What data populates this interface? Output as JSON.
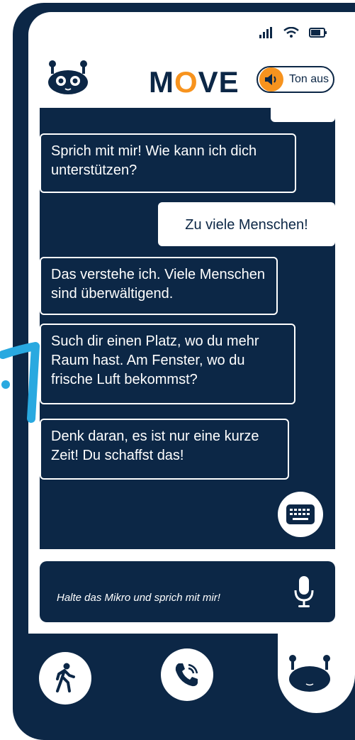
{
  "header": {
    "logo_text_left": "M",
    "logo_text_o": "O",
    "logo_text_right": "VE",
    "sound_label": "Ton aus"
  },
  "status_bar": {
    "icons": [
      "signal-icon",
      "wifi-icon",
      "battery-icon"
    ]
  },
  "messages": [
    {
      "from": "bot",
      "text": "Sprich mit mir! Wie kann ich dich unterstützen?"
    },
    {
      "from": "user",
      "text": "Zu viele Menschen!"
    },
    {
      "from": "bot",
      "text": "Das verstehe ich. Viele Menschen sind überwältigend."
    },
    {
      "from": "bot",
      "text": "Such dir einen Platz, wo du mehr Raum hast. Am Fenster, wo du frische Luft bekommst?"
    },
    {
      "from": "bot",
      "text": "Denk daran, es ist nur eine kurze Zeit! Du schaffst das!"
    }
  ],
  "input": {
    "placeholder": "Halte das Mikro und sprich mit mir!"
  },
  "nav": {
    "items": [
      "walk-icon",
      "phone-icon",
      "robot-icon"
    ],
    "active": "robot-icon"
  },
  "colors": {
    "navy": "#0c2746",
    "orange": "#f7931e",
    "accent_blue": "#29a9e0"
  }
}
